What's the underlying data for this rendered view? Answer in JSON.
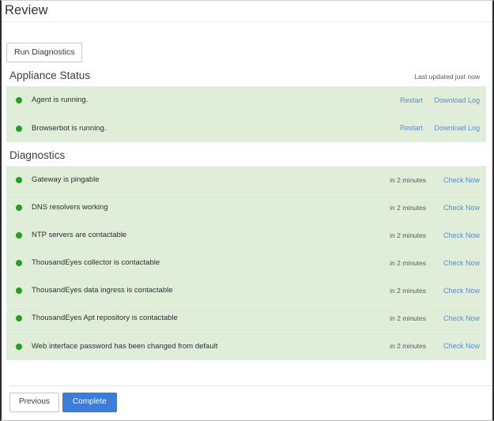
{
  "page": {
    "title": "Review"
  },
  "toolbar": {
    "run_diagnostics_label": "Run Diagnostics"
  },
  "appliance_status": {
    "title": "Appliance Status",
    "last_updated": "Last updated just now",
    "actions": {
      "restart_label": "Restart",
      "download_log_label": "Download Log"
    },
    "rows": [
      {
        "label": "Agent is running.",
        "status": "ok"
      },
      {
        "label": "Browserbot is running.",
        "status": "ok"
      }
    ]
  },
  "diagnostics": {
    "title": "Diagnostics",
    "check_now_label": "Check Now",
    "rows": [
      {
        "label": "Gateway is pingable",
        "status": "ok",
        "next_check": "in 2 minutes"
      },
      {
        "label": "DNS resolvers working",
        "status": "ok",
        "next_check": "in 2 minutes"
      },
      {
        "label": "NTP servers are contactable",
        "status": "ok",
        "next_check": "in 2 minutes"
      },
      {
        "label": "ThousandEyes collector is contactable",
        "status": "ok",
        "next_check": "in 2 minutes"
      },
      {
        "label": "ThousandEyes data ingress is contactable",
        "status": "ok",
        "next_check": "in 2 minutes"
      },
      {
        "label": "ThousandEyes Apt repository is contactable",
        "status": "ok",
        "next_check": "in 2 minutes"
      },
      {
        "label": "Web interface password has been changed from default",
        "status": "ok",
        "next_check": "in 2 minutes"
      }
    ]
  },
  "footer": {
    "previous_label": "Previous",
    "complete_label": "Complete"
  },
  "colors": {
    "status_ok": "#21a025",
    "panel_background": "#dfedd9",
    "link": "#5b8fc9",
    "primary_button": "#3b7dd8"
  }
}
